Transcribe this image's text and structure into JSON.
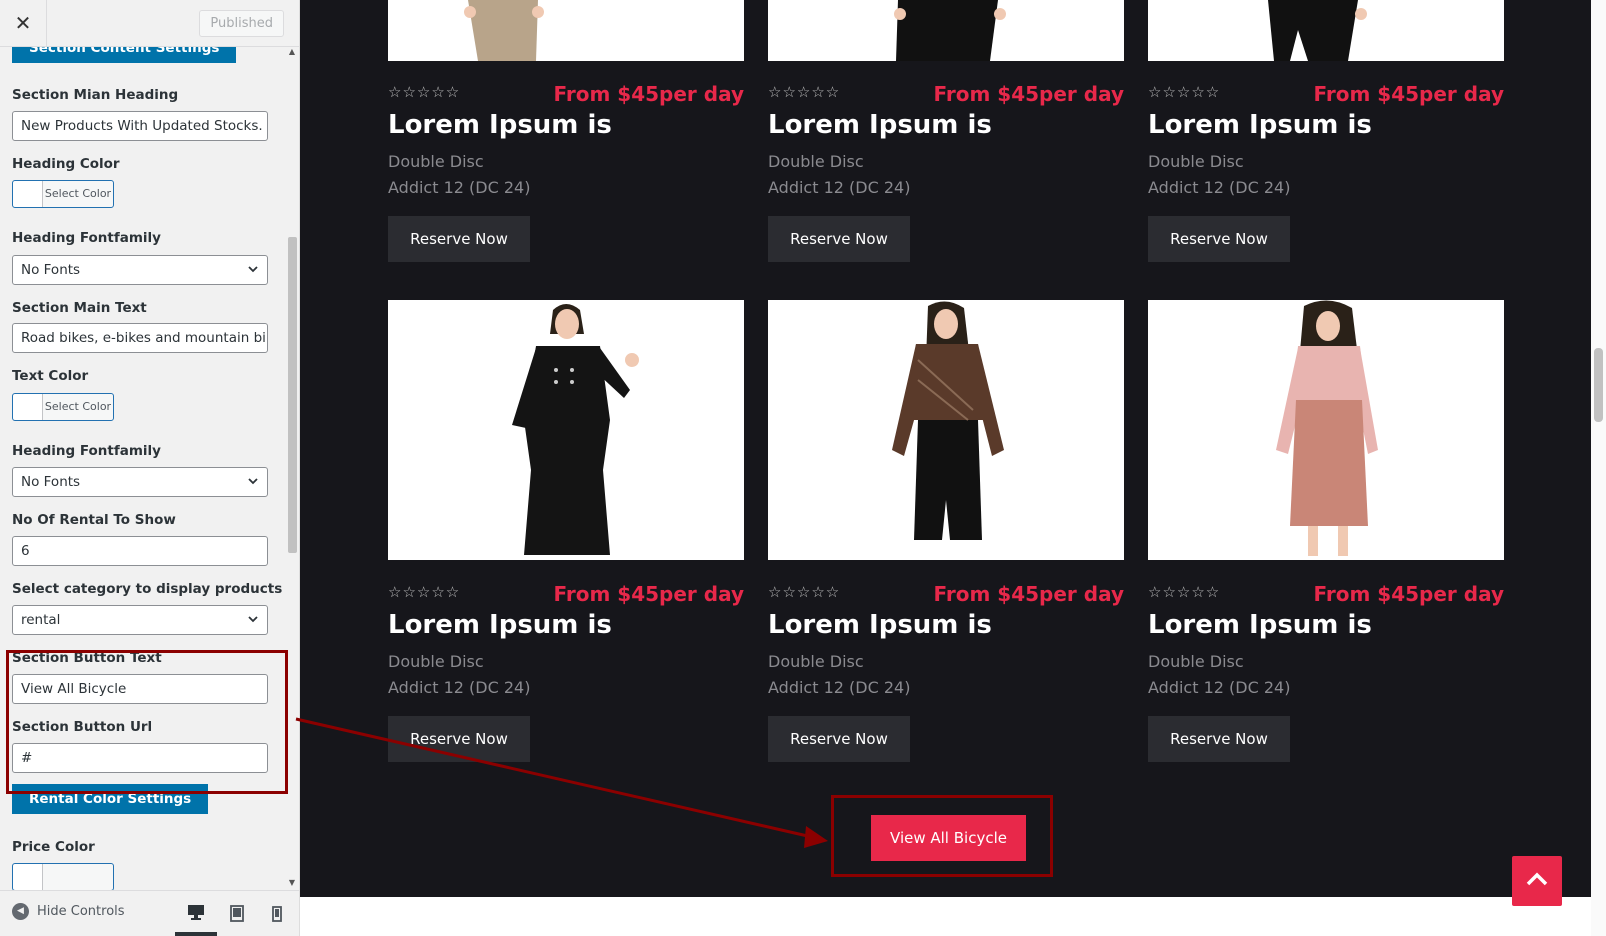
{
  "header": {
    "close_glyph": "✕",
    "published_label": "Published"
  },
  "sidebar": {
    "section_content_settings": "Section Content Settings",
    "fields": [
      {
        "label": "Section Mian Heading",
        "value": "New Products With Updated Stocks."
      },
      {
        "label": "Heading Color",
        "button": "Select Color"
      },
      {
        "label": "Heading Fontfamily",
        "value": "No Fonts"
      },
      {
        "label": "Section Main Text",
        "value": "Road bikes, e-bikes and mountain bikes"
      },
      {
        "label": "Text Color",
        "button": "Select Color"
      },
      {
        "label": "Heading Fontfamily",
        "value": "No Fonts"
      },
      {
        "label": "No Of Rental To Show",
        "value": "6"
      },
      {
        "label": "Select category to display products",
        "value": "rental"
      },
      {
        "label": "Section Button Text",
        "value": "View All Bicycle"
      },
      {
        "label": "Section Button Url",
        "value": "#"
      }
    ],
    "rental_color_settings": "Rental Color Settings",
    "price_color_label": "Price Color"
  },
  "footer": {
    "hide_controls": "Hide Controls"
  },
  "products": [
    {
      "price": "From $45per day",
      "title": "Lorem Ipsum is",
      "desc1": "Double Disc",
      "desc2": "Addict 12 (DC 24)",
      "button": "Reserve Now"
    },
    {
      "price": "From $45per day",
      "title": "Lorem Ipsum is",
      "desc1": "Double Disc",
      "desc2": "Addict 12 (DC 24)",
      "button": "Reserve Now"
    },
    {
      "price": "From $45per day",
      "title": "Lorem Ipsum is",
      "desc1": "Double Disc",
      "desc2": "Addict 12 (DC 24)",
      "button": "Reserve Now"
    },
    {
      "price": "From $45per day",
      "title": "Lorem Ipsum is",
      "desc1": "Double Disc",
      "desc2": "Addict 12 (DC 24)",
      "button": "Reserve Now"
    },
    {
      "price": "From $45per day",
      "title": "Lorem Ipsum is",
      "desc1": "Double Disc",
      "desc2": "Addict 12 (DC 24)",
      "button": "Reserve Now"
    },
    {
      "price": "From $45per day",
      "title": "Lorem Ipsum is",
      "desc1": "Double Disc",
      "desc2": "Addict 12 (DC 24)",
      "button": "Reserve Now"
    }
  ],
  "rating_stars": "☆☆☆☆☆",
  "view_all_button": "View All Bicycle",
  "colors": {
    "accent": "#e8284a",
    "dark_bg": "#16161b",
    "wp_blue": "#0073aa",
    "annotation": "#8b0000"
  },
  "icons": [
    "close-icon",
    "chevron-down-icon",
    "desktop-icon",
    "tablet-icon",
    "mobile-icon",
    "arrow-up-icon",
    "hide-controls-icon"
  ]
}
